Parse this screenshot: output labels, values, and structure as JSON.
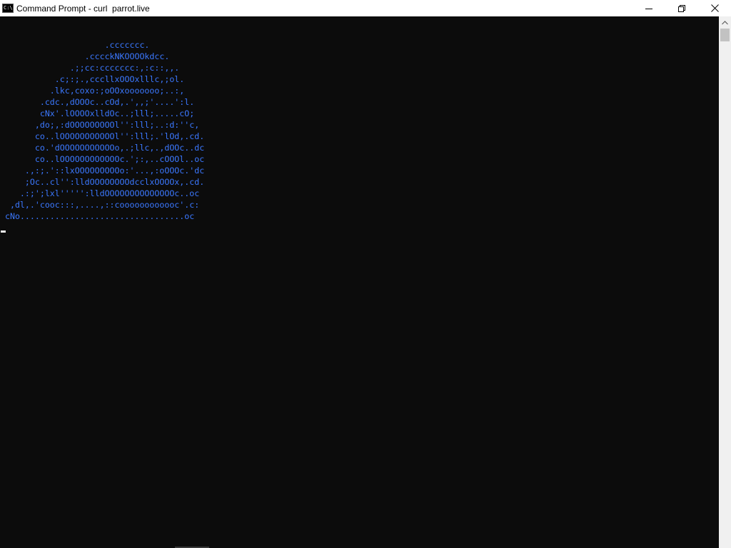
{
  "window": {
    "title": "Command Prompt - curl  parrot.live",
    "icon": "cmd-icon",
    "icon_text": "C:\\",
    "controls": {
      "minimize": "minimize-icon",
      "maximize": "restore-icon",
      "close": "close-icon"
    }
  },
  "console": {
    "text_color": "#3b78ff",
    "background": "#0c0c0c",
    "art_lines": [
      "                     .ccccccc.",
      "                 .cccckNKOOOOkdcc.",
      "              .;;cc:ccccccc:,:c::,,.",
      "           .c;:;.,cccllxOOOxlllc,;ol.",
      "          .lkc,coxo:;oOOxooooooo;..:,",
      "        .cdc.,dOOOc..cOd,.',,;'....':l.",
      "        cNx'.lOOOOxlldOc..;lll;.....cO;",
      "       ,do;,:dOOOOOOOOOl'':lll;..:d:''c,",
      "       co..lOOOOOOOOOOOl'':lll;.'lOd,.cd.",
      "       co.'dOOOOOOOOOOOo,.;llc,.,dOOc..dc",
      "       co..lOOOOOOOOOOOOc.';:,..cOOOl..oc",
      "     .,:;.'::lxOOOOOOOOOo:'...,:oOOOc.'dc",
      "     ;Oc..cl'':lldOOOOOOOOdcclxOOOOx,.cd.",
      "    .:;';lxl''''':lldOOOOOOOOOOOOOOc..oc",
      "  ,dl,.'cooc:::,....,::coooooooooooc'.c:",
      " cNo.................................oc"
    ]
  }
}
